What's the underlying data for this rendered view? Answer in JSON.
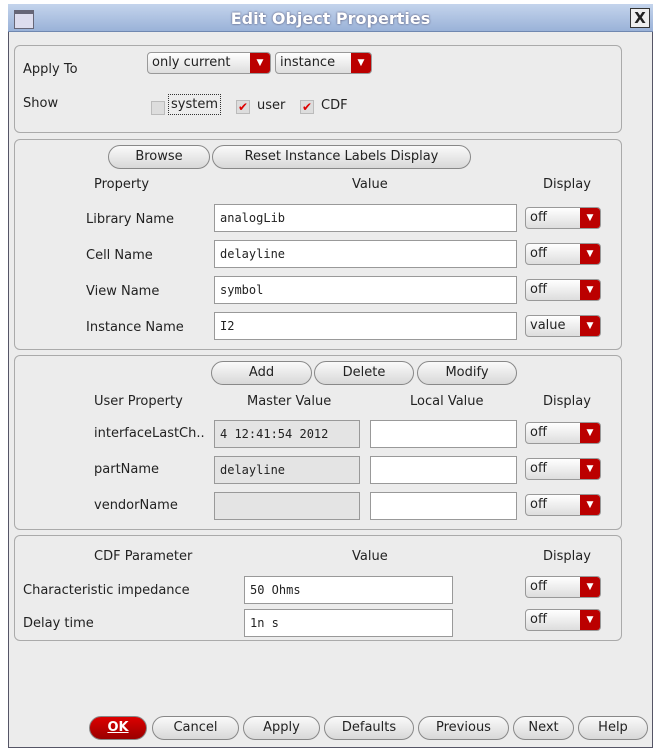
{
  "window": {
    "title": "Edit Object Properties",
    "close": "X"
  },
  "apply": {
    "label": "Apply To",
    "scope": "only current",
    "type": "instance"
  },
  "show": {
    "label": "Show",
    "system": "system",
    "user": "user",
    "cdf": "CDF",
    "system_checked": false,
    "user_checked": true,
    "cdf_checked": true
  },
  "props": {
    "browse": "Browse",
    "reset": "Reset Instance Labels Display",
    "h_property": "Property",
    "h_value": "Value",
    "h_display": "Display",
    "rows": [
      {
        "name": "Library Name",
        "value": "analogLib",
        "display": "off"
      },
      {
        "name": "Cell Name",
        "value": "delayline",
        "display": "off"
      },
      {
        "name": "View Name",
        "value": "symbol",
        "display": "off"
      },
      {
        "name": "Instance Name",
        "value": "I2",
        "display": "value"
      }
    ]
  },
  "user": {
    "add": "Add",
    "delete": "Delete",
    "modify": "Modify",
    "h_prop": "User Property",
    "h_master": "Master Value",
    "h_local": "Local Value",
    "h_display": "Display",
    "rows": [
      {
        "name": "interfaceLastCh..",
        "master": "4 12:41:54 2012",
        "local": "",
        "display": "off"
      },
      {
        "name": "partName",
        "master": "delayline",
        "local": "",
        "display": "off"
      },
      {
        "name": "vendorName",
        "master": "",
        "local": "",
        "display": "off"
      }
    ]
  },
  "cdf": {
    "h_param": "CDF Parameter",
    "h_value": "Value",
    "h_display": "Display",
    "rows": [
      {
        "name": "Characteristic impedance",
        "value": "50 Ohms",
        "display": "off"
      },
      {
        "name": "Delay time",
        "value": "1n s",
        "display": "off"
      }
    ]
  },
  "buttons": {
    "ok": "OK",
    "cancel": "Cancel",
    "apply": "Apply",
    "defaults": "Defaults",
    "previous": "Previous",
    "next": "Next",
    "help": "Help"
  },
  "colors": {
    "accent": "#b00000",
    "titlebar": "#a8bde0"
  }
}
